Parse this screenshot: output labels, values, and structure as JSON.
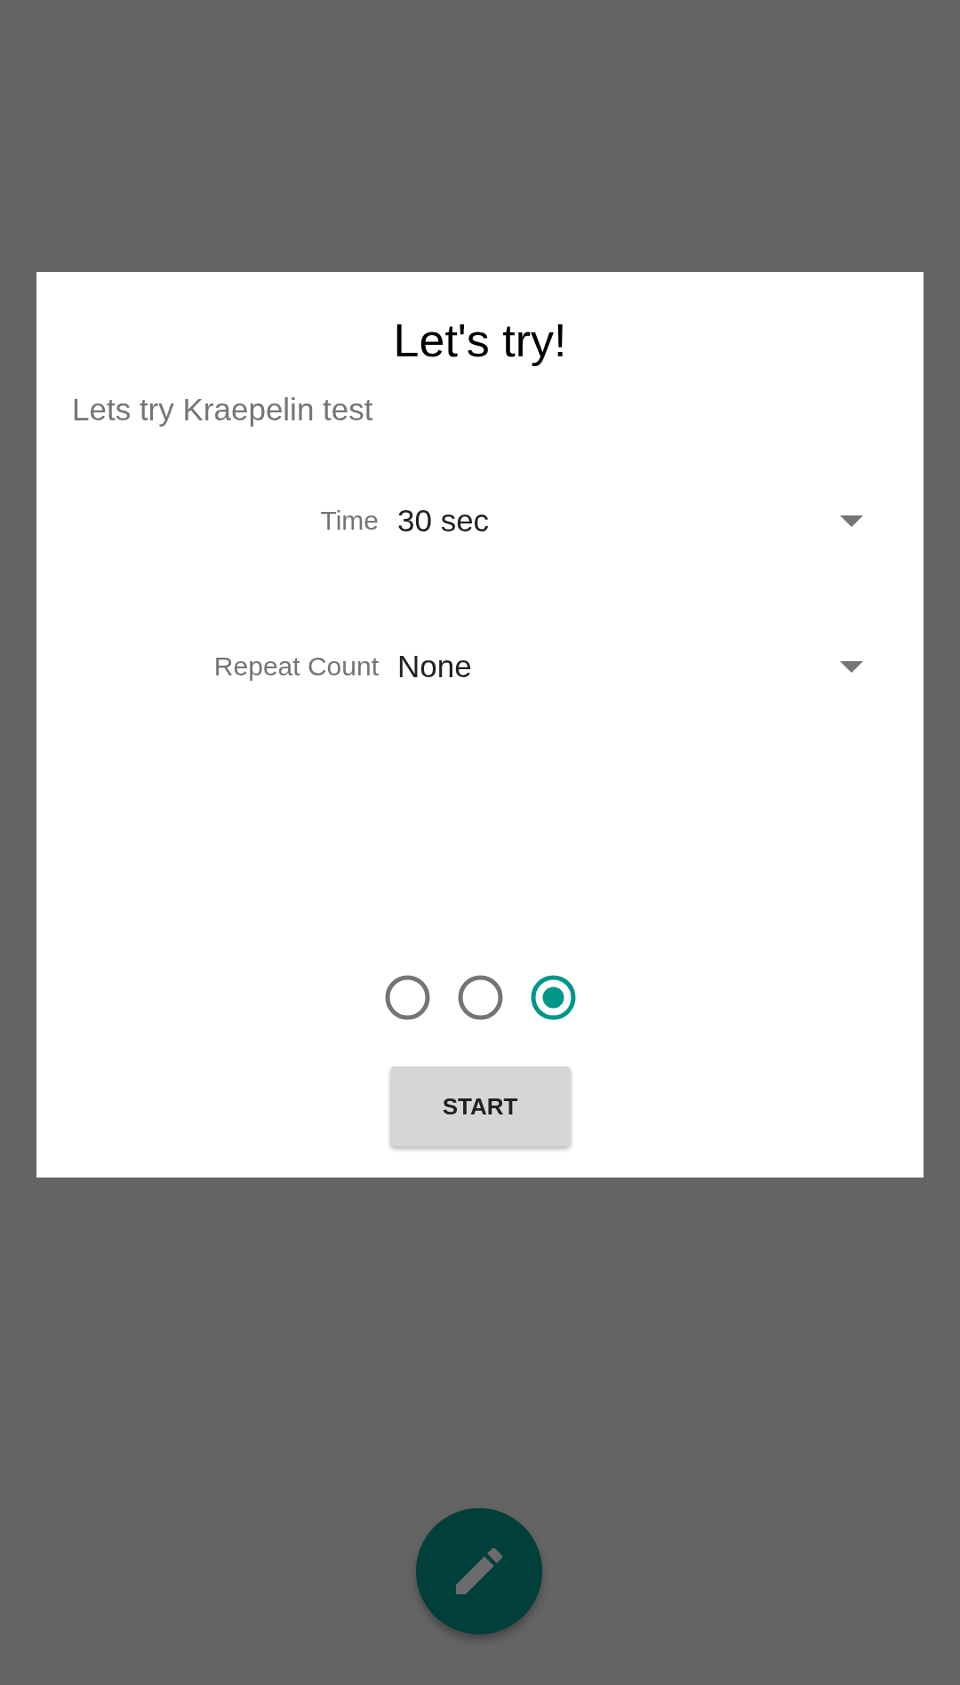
{
  "dialog": {
    "title": "Let's try!",
    "message": "Lets try Kraepelin test",
    "fields": [
      {
        "label": "Time",
        "value": "30 sec"
      },
      {
        "label": "Repeat Count",
        "value": "None"
      }
    ],
    "radio_buttons": [
      {
        "selected": false
      },
      {
        "selected": false
      },
      {
        "selected": true
      }
    ],
    "button": "START"
  }
}
